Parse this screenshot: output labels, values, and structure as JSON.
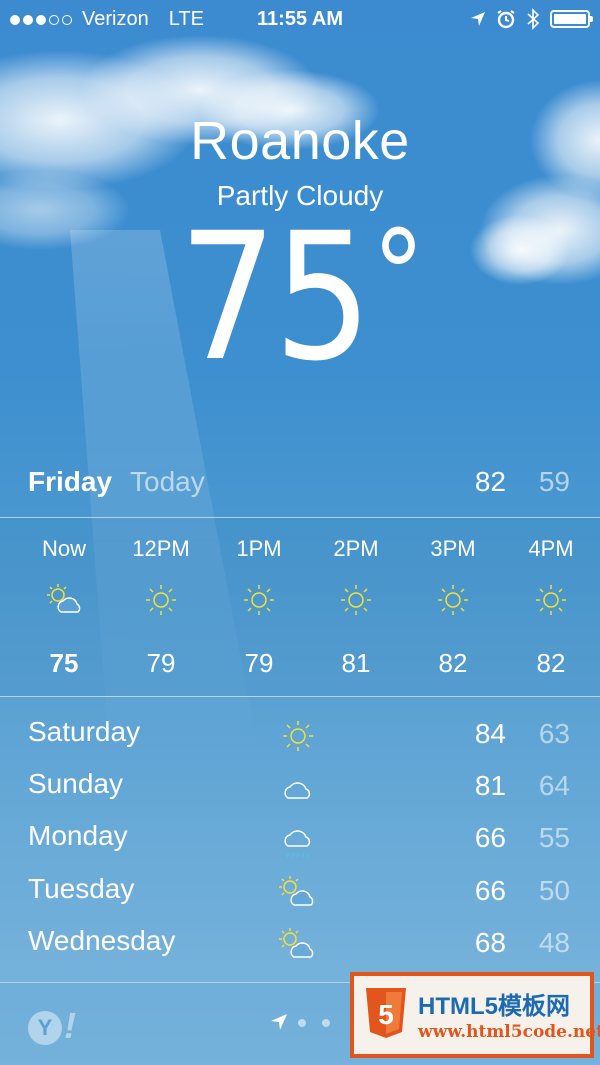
{
  "status_bar": {
    "signal_dots": [
      "on",
      "on",
      "on",
      "off",
      "off"
    ],
    "carrier": "Verizon",
    "network": "LTE",
    "time": "11:55 AM",
    "icons": [
      "location-arrow-icon",
      "alarm-clock-icon",
      "bluetooth-icon",
      "battery-icon"
    ],
    "battery_level": 1.0
  },
  "location": {
    "city": "Roanoke",
    "condition": "Partly Cloudy",
    "temperature": "75",
    "degree_symbol": "°"
  },
  "today": {
    "day": "Friday",
    "label": "Today",
    "high": "82",
    "low": "59"
  },
  "hourly": [
    {
      "time": "Now",
      "icon": "partly-cloudy-icon",
      "temp": "75"
    },
    {
      "time": "12PM",
      "icon": "sun-icon",
      "temp": "79"
    },
    {
      "time": "1PM",
      "icon": "sun-icon",
      "temp": "79"
    },
    {
      "time": "2PM",
      "icon": "sun-icon",
      "temp": "81"
    },
    {
      "time": "3PM",
      "icon": "sun-icon",
      "temp": "82"
    },
    {
      "time": "4PM",
      "icon": "sun-icon",
      "temp": "82"
    }
  ],
  "daily": [
    {
      "day": "Saturday",
      "icon": "sun-icon",
      "high": "84",
      "low": "63"
    },
    {
      "day": "Sunday",
      "icon": "cloud-icon",
      "high": "81",
      "low": "64"
    },
    {
      "day": "Monday",
      "icon": "rain-cloud-icon",
      "high": "66",
      "low": "55"
    },
    {
      "day": "Tuesday",
      "icon": "partly-cloudy-icon",
      "high": "66",
      "low": "50"
    },
    {
      "day": "Wednesday",
      "icon": "partly-cloudy-icon",
      "high": "68",
      "low": "48"
    }
  ],
  "footer": {
    "logo_letter": "Y",
    "logo_mark": "!",
    "page_indicator": [
      "location-arrow-icon",
      "dot",
      "dot"
    ]
  },
  "watermark": {
    "title": "HTML5模板网",
    "url": "www.html5code.net",
    "shield_text": "5"
  },
  "colors": {
    "sky_top": "#3c8bd0",
    "sky_bottom": "#7db6dd",
    "sun": "#f4e033",
    "rain": "#4fc0f0",
    "watermark_border": "#e2561d",
    "watermark_title": "#1c6bb2"
  }
}
